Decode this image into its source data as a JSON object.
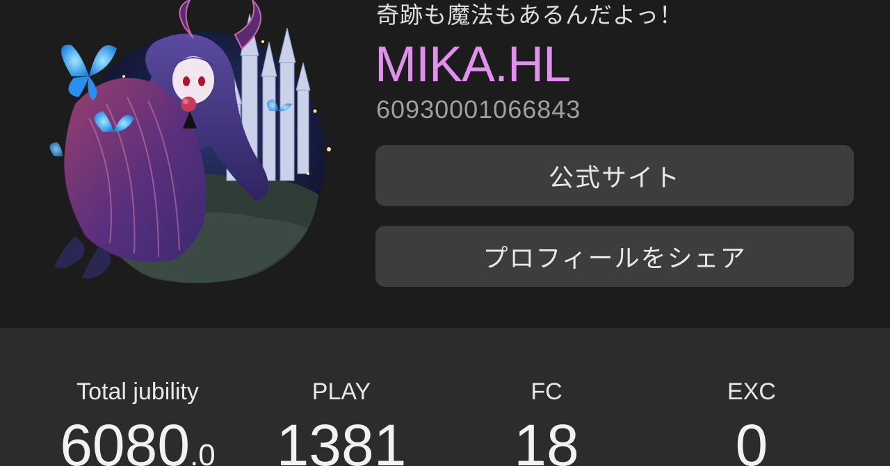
{
  "profile": {
    "avatar_alt": "player-avatar",
    "subtitle": "奇跡も魔法もあるんだよっ！",
    "name": "MIKA.HL",
    "name_color": "#e38ff0",
    "id": "60930001066843",
    "buttons": {
      "official_site": "公式サイト",
      "share_profile": "プロフィールをシェア"
    }
  },
  "stats": [
    {
      "label": "Total jubility",
      "value": "6080",
      "decimal": ".0"
    },
    {
      "label": "PLAY",
      "value": "1381",
      "decimal": ""
    },
    {
      "label": "FC",
      "value": "18",
      "decimal": ""
    },
    {
      "label": "EXC",
      "value": "0",
      "decimal": ""
    }
  ],
  "colors": {
    "background": "#1c1c1c",
    "stats_background": "#2c2c2c",
    "button_background": "#3d3d3d",
    "accent": "#e38ff0"
  }
}
